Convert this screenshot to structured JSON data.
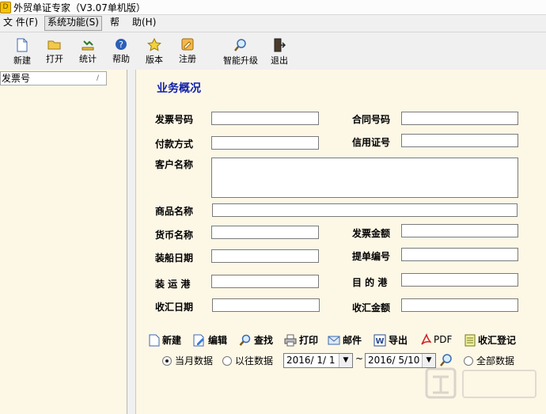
{
  "window": {
    "title": "外贸单证专家（V3.07单机版）"
  },
  "menu": [
    {
      "label": "文 件(F)"
    },
    {
      "label": "系统功能(S)"
    },
    {
      "label": "帮"
    },
    {
      "label": "助(H)"
    }
  ],
  "toolbar": [
    {
      "label": "新建",
      "icon": "new-doc-icon"
    },
    {
      "label": "打开",
      "icon": "folder-open-icon"
    },
    {
      "label": "统计",
      "icon": "statistics-icon"
    },
    {
      "label": "帮助",
      "icon": "help-icon"
    },
    {
      "label": "版本",
      "icon": "star-icon"
    },
    {
      "label": "注册",
      "icon": "register-icon"
    },
    {
      "label": "智能升级",
      "icon": "magnifier-icon"
    },
    {
      "label": "退出",
      "icon": "exit-door-icon"
    }
  ],
  "left_panel": {
    "column_header": "发票号"
  },
  "main": {
    "section_title": "业务概况",
    "fields": {
      "invoice_no": {
        "label": "发票号码",
        "value": ""
      },
      "contract_no": {
        "label": "合同号码",
        "value": ""
      },
      "payment": {
        "label": "付款方式",
        "value": ""
      },
      "lc_no": {
        "label": "信用证号",
        "value": ""
      },
      "customer": {
        "label": "客户名称",
        "value": ""
      },
      "goods": {
        "label": "商品名称",
        "value": ""
      },
      "currency": {
        "label": "货币名称",
        "value": ""
      },
      "invoice_amount": {
        "label": "发票金额",
        "value": ""
      },
      "ship_date": {
        "label": "装船日期",
        "value": ""
      },
      "bl_no": {
        "label": "提单编号",
        "value": ""
      },
      "port_loading": {
        "label": "装 运 港",
        "value": ""
      },
      "port_dest": {
        "label": "目 的 港",
        "value": ""
      },
      "receipt_date": {
        "label": "收汇日期",
        "value": ""
      },
      "receipt_amount": {
        "label": "收汇金额",
        "value": ""
      }
    },
    "actions": [
      {
        "label": "新建",
        "icon": "new-doc-icon"
      },
      {
        "label": "编辑",
        "icon": "edit-icon"
      },
      {
        "label": "查找",
        "icon": "search-icon"
      },
      {
        "label": "打印",
        "icon": "printer-icon"
      },
      {
        "label": "邮件",
        "icon": "mail-icon"
      },
      {
        "label": "导出",
        "icon": "export-word-icon"
      },
      {
        "label": "PDF",
        "icon": "pdf-icon"
      },
      {
        "label": "收汇登记",
        "icon": "register-sheet-icon"
      }
    ],
    "filter": {
      "option_current": "当月数据",
      "option_past": "以往数据",
      "option_all": "全部数据",
      "selected": "当月数据",
      "date_from": "2016/ 1/ 1",
      "separator": "~",
      "date_to": "2016/ 5/10"
    }
  },
  "colors": {
    "panel_bg": "#fdf7e6",
    "title_blue": "#1020a8",
    "window_bg": "#f0f0f0"
  }
}
